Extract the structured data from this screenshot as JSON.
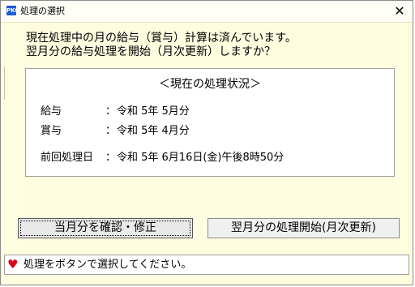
{
  "window": {
    "title": "処理の選択",
    "icon": "app-icon",
    "icon_text": "PKO",
    "close_label": "✕"
  },
  "question": {
    "line1": "現在処理中の月の給与（賞与）計算は済んでいます。",
    "line2": "翌月分の給与処理を開始（月次更新）しますか？"
  },
  "status_panel": {
    "title": "＜現在の処理状況＞",
    "rows": [
      {
        "label": "給与",
        "colon": "：",
        "value": "令和 5年 5月分"
      },
      {
        "label": "賞与",
        "colon": "：",
        "value": "令和 5年 4月分"
      }
    ],
    "last": {
      "label": "前回処理日",
      "colon": "：",
      "value": "令和 5年 6月16日(金)午後8時50分"
    }
  },
  "buttons": {
    "confirm_label": "当月分を確認・修正",
    "start_label": "翌月分の処理開始(月次更新)"
  },
  "statusbar": {
    "icon": "heart-icon",
    "message": "処理をボタンで選択してください。"
  },
  "colors": {
    "background": "#fffde0",
    "heart": "#e0001b",
    "app_icon": "#1e5bd6"
  }
}
